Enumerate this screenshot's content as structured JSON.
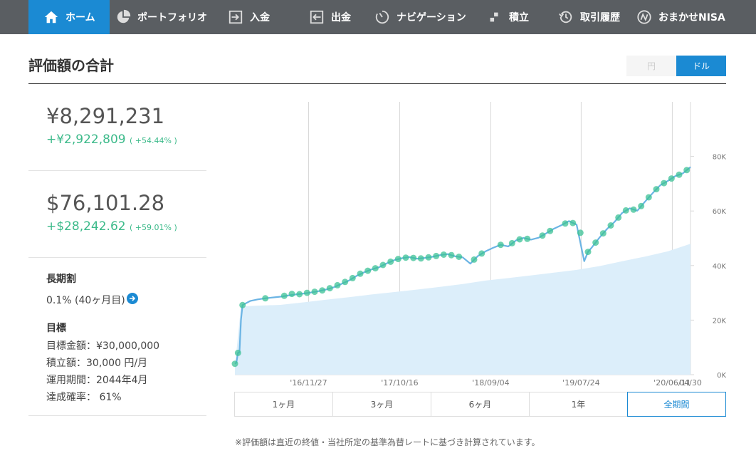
{
  "nav": {
    "items": [
      {
        "label": "ホーム",
        "icon": "home-icon",
        "active": true
      },
      {
        "label": "ポートフォリオ",
        "icon": "pie-chart-icon"
      },
      {
        "label": "入金",
        "icon": "deposit-icon"
      },
      {
        "label": "出金",
        "icon": "withdraw-icon"
      },
      {
        "label": "ナビゲーション",
        "icon": "gauge-icon"
      },
      {
        "label": "積立",
        "icon": "blocks-icon"
      },
      {
        "label": "取引履歴",
        "icon": "history-icon"
      },
      {
        "label": "おまかせNISA",
        "icon": "nisa-logo-icon"
      }
    ]
  },
  "header": {
    "title": "評価額の合計",
    "currency_yen": "円",
    "currency_usd": "ドル",
    "selected_currency": "ドル"
  },
  "summary": {
    "yen_total": "¥8,291,231",
    "yen_gain": "+¥2,922,809",
    "yen_gain_pct": "( +54.44% )",
    "usd_total": "$76,101.28",
    "usd_gain": "+$28,242.62",
    "usd_gain_pct": "( +59.01% )"
  },
  "long_term": {
    "heading": "長期割",
    "value": "0.1% (40ヶ月目)"
  },
  "goal": {
    "heading": "目標",
    "target_amount": "目標金額：¥30,000,000",
    "monthly": "積立額：30,000 円/月",
    "period": "運用期間：2044年4月",
    "achievement": "達成確率： 61%"
  },
  "ranges": {
    "items": [
      "1ヶ月",
      "3ヶ月",
      "6ヶ月",
      "1年",
      "全期間"
    ],
    "selected": "全期間"
  },
  "note": "※評価額は直近の終値・当社所定の基準為替レートに基づき計算されています。",
  "colors": {
    "nav_bg": "#5a5e62",
    "accent": "#1b8ad3",
    "gain": "#3cba8a",
    "line": "#6bb4e4",
    "area": "#dceefa",
    "marker": "#3cc195"
  },
  "chart_data": {
    "type": "line",
    "x_ticks": [
      "'16/11/27",
      "'17/10/16",
      "'18/09/04",
      "'19/07/24",
      "'20/06/11",
      "04/30"
    ],
    "y_ticks": [
      "0K",
      "20K",
      "40K",
      "60K",
      "80K"
    ],
    "ylim": [
      0,
      100000
    ],
    "x_range": [
      0,
      60
    ],
    "x_tick_positions": [
      9.7,
      21.7,
      33.7,
      45.6,
      57.6,
      60
    ],
    "series": [
      {
        "values": [
          [
            0.0,
            4000
          ],
          [
            0.2,
            4500
          ],
          [
            0.4,
            8000
          ],
          [
            0.6,
            8200
          ],
          [
            0.8,
            20000
          ],
          [
            1.0,
            25500
          ],
          [
            2,
            27000
          ],
          [
            3,
            27600
          ],
          [
            4,
            28000
          ],
          [
            5,
            28300
          ],
          [
            6,
            28600
          ],
          [
            7,
            29000
          ],
          [
            8,
            29400
          ],
          [
            9,
            29700
          ],
          [
            10,
            30100
          ],
          [
            11,
            30600
          ],
          [
            12,
            31200
          ],
          [
            13,
            32000
          ],
          [
            14,
            33200
          ],
          [
            15,
            34500
          ],
          [
            16,
            36200
          ],
          [
            17,
            37500
          ],
          [
            18,
            38600
          ],
          [
            19,
            39400
          ],
          [
            20,
            40800
          ],
          [
            21,
            42000
          ],
          [
            22,
            42700
          ],
          [
            23,
            43100
          ],
          [
            24,
            42500
          ],
          [
            25,
            42800
          ],
          [
            26,
            43200
          ],
          [
            27,
            43800
          ],
          [
            28,
            44200
          ],
          [
            29,
            43400
          ],
          [
            30,
            43000
          ],
          [
            31,
            40700
          ],
          [
            32,
            43500
          ],
          [
            33,
            45200
          ],
          [
            34,
            46500
          ],
          [
            35,
            47600
          ],
          [
            36,
            47000
          ],
          [
            37,
            49200
          ],
          [
            38,
            50100
          ],
          [
            39,
            49500
          ],
          [
            40,
            50200
          ],
          [
            41,
            51800
          ],
          [
            42,
            53500
          ],
          [
            43,
            54800
          ],
          [
            44,
            56300
          ],
          [
            45,
            55000
          ],
          [
            45.6,
            47000
          ],
          [
            46,
            41600
          ],
          [
            46.5,
            45000
          ],
          [
            47,
            46600
          ],
          [
            48,
            50200
          ],
          [
            49,
            53400
          ],
          [
            50,
            56000
          ],
          [
            51,
            59300
          ],
          [
            52,
            61000
          ],
          [
            53,
            60100
          ],
          [
            54,
            63400
          ],
          [
            55,
            66500
          ],
          [
            56,
            69400
          ],
          [
            57,
            71000
          ],
          [
            58,
            72800
          ],
          [
            59,
            73800
          ],
          [
            60,
            76100
          ]
        ],
        "markers": [
          [
            0.0,
            4000
          ],
          [
            0.4,
            8000
          ],
          [
            1.0,
            25500
          ],
          [
            4,
            28000
          ],
          [
            6.5,
            28900
          ],
          [
            7.5,
            29600
          ],
          [
            8.5,
            29500
          ],
          [
            9.5,
            30000
          ],
          [
            10.5,
            30400
          ],
          [
            11.5,
            30900
          ],
          [
            12.5,
            31700
          ],
          [
            13.5,
            32800
          ],
          [
            14.5,
            34000
          ],
          [
            15.5,
            35400
          ],
          [
            16.5,
            37000
          ],
          [
            17.5,
            38100
          ],
          [
            18.5,
            39000
          ],
          [
            19.5,
            40200
          ],
          [
            20.5,
            41400
          ],
          [
            21.5,
            42400
          ],
          [
            22.5,
            42900
          ],
          [
            23.5,
            42800
          ],
          [
            24.5,
            42600
          ],
          [
            25.5,
            43000
          ],
          [
            26.5,
            43500
          ],
          [
            27.5,
            44000
          ],
          [
            28.5,
            43800
          ],
          [
            29.5,
            43200
          ],
          [
            31.5,
            42200
          ],
          [
            32.5,
            44400
          ],
          [
            35,
            47600
          ],
          [
            36.5,
            48200
          ],
          [
            37.5,
            49600
          ],
          [
            38.5,
            49800
          ],
          [
            40.5,
            51000
          ],
          [
            41.5,
            52700
          ],
          [
            43.5,
            55400
          ],
          [
            44.5,
            55600
          ],
          [
            45.5,
            52000
          ],
          [
            46.5,
            45000
          ],
          [
            47.5,
            48400
          ],
          [
            48.5,
            51800
          ],
          [
            49.5,
            54700
          ],
          [
            50.5,
            57600
          ],
          [
            51.5,
            60200
          ],
          [
            52.5,
            60500
          ],
          [
            53.5,
            61800
          ],
          [
            54.5,
            65000
          ],
          [
            55.5,
            68000
          ],
          [
            56.5,
            70200
          ],
          [
            57.5,
            71900
          ],
          [
            58.5,
            73300
          ],
          [
            59.5,
            75000
          ]
        ]
      },
      {
        "values": [
          [
            0.0,
            3000
          ],
          [
            0.8,
            25000
          ],
          [
            3,
            25300
          ],
          [
            6,
            25600
          ],
          [
            9,
            26500
          ],
          [
            12,
            27500
          ],
          [
            15,
            28400
          ],
          [
            18,
            29400
          ],
          [
            21,
            30300
          ],
          [
            24,
            31200
          ],
          [
            27,
            32200
          ],
          [
            30,
            33200
          ],
          [
            33,
            34500
          ],
          [
            36,
            35400
          ],
          [
            39,
            36400
          ],
          [
            42,
            37400
          ],
          [
            45,
            38400
          ],
          [
            48,
            39800
          ],
          [
            51,
            41600
          ],
          [
            54,
            43300
          ],
          [
            57,
            45200
          ],
          [
            60,
            48000
          ]
        ]
      }
    ]
  }
}
